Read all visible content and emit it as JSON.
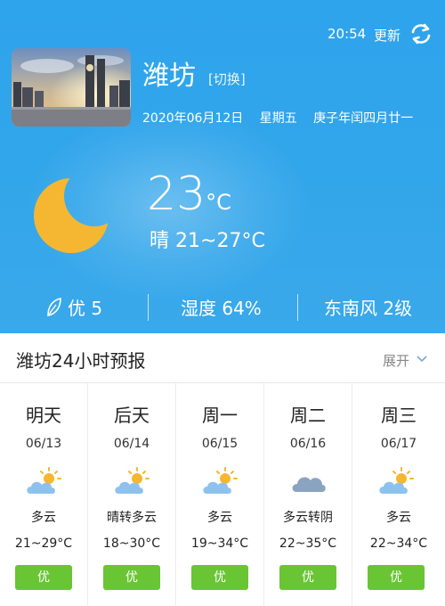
{
  "header": {
    "time": "20:54",
    "update_label": "更新",
    "refresh_icon": "refresh-icon"
  },
  "location": {
    "city": "潍坊",
    "switch_label": "[切换]",
    "date": "2020年06月12日",
    "weekday": "星期五",
    "lunar": "庚子年闰四月廿一"
  },
  "current": {
    "icon": "crescent-moon-icon",
    "temperature": "23",
    "unit": "°C",
    "condition": "晴",
    "range": "21~27°C"
  },
  "stats": {
    "aqi_icon": "leaf-icon",
    "aqi": "优 5",
    "humidity": "湿度 64%",
    "wind": "东南风 2级"
  },
  "forecast": {
    "title": "潍坊24小时预报",
    "expand_label": "展开",
    "days": [
      {
        "name": "明天",
        "date": "06/13",
        "icon": "partly-cloudy-icon",
        "condition": "多云",
        "range": "21~29°C",
        "aqi": "优"
      },
      {
        "name": "后天",
        "date": "06/14",
        "icon": "partly-cloudy-icon",
        "condition": "晴转多云",
        "range": "18~30°C",
        "aqi": "优"
      },
      {
        "name": "周一",
        "date": "06/15",
        "icon": "partly-cloudy-icon",
        "condition": "多云",
        "range": "19~34°C",
        "aqi": "优"
      },
      {
        "name": "周二",
        "date": "06/16",
        "icon": "cloudy-icon",
        "condition": "多云转阴",
        "range": "22~35°C",
        "aqi": "优"
      },
      {
        "name": "周三",
        "date": "06/17",
        "icon": "partly-cloudy-icon",
        "condition": "多云",
        "range": "22~34°C",
        "aqi": "优"
      }
    ]
  },
  "colors": {
    "hero_blue": "#33a6ea",
    "moon_yellow": "#f5b731",
    "aqi_green": "#69c534"
  }
}
